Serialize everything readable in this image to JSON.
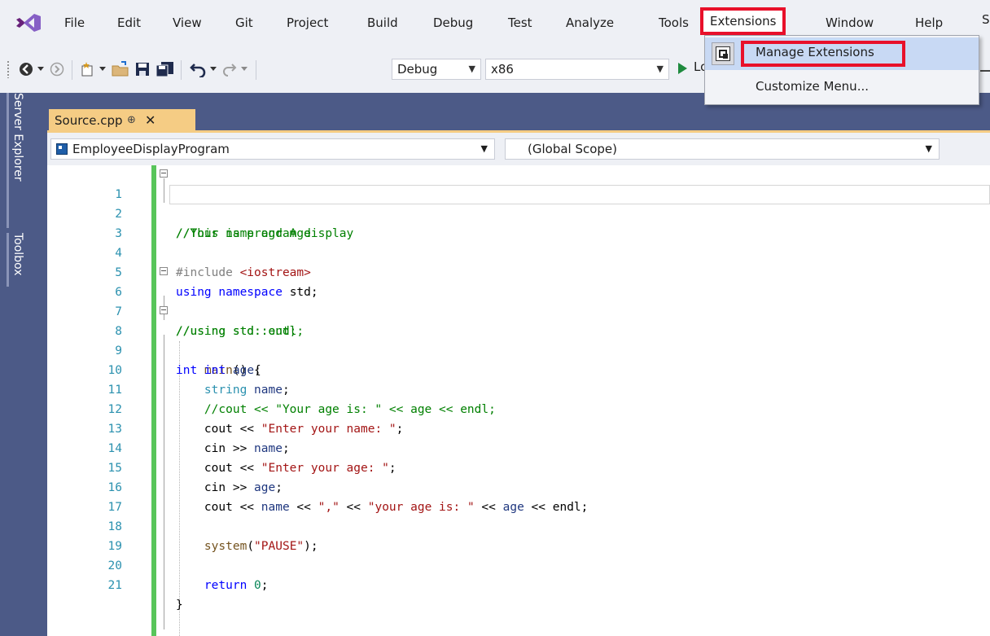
{
  "menubar": {
    "items": [
      "File",
      "Edit",
      "View",
      "Git",
      "Project",
      "Build",
      "Debug",
      "Test",
      "Analyze",
      "Tools",
      "Extensions",
      "Window",
      "Help"
    ],
    "cut_item": "S"
  },
  "toolbar": {
    "configuration": "Debug",
    "platform": "x86",
    "run_label": "Lo"
  },
  "leftstrip": {
    "server_explorer": "Server Explorer",
    "toolbox": "Toolbox"
  },
  "tab": {
    "filename": "Source.cpp",
    "pin": "⊕",
    "close": "✕"
  },
  "navbar": {
    "project": "EmployeeDisplayProgram",
    "scope": "(Global Scope)"
  },
  "dropdown": {
    "items": [
      "Manage Extensions",
      "Customize Menu..."
    ]
  },
  "code": {
    "lines": [
      "1",
      "2",
      "3",
      "4",
      "5",
      "6",
      "7",
      "8",
      "9",
      "10",
      "11",
      "12",
      "13",
      "14",
      "15",
      "16",
      "17",
      "18",
      "19",
      "20",
      "21"
    ],
    "l1": "//This is program display",
    "l2": "//Your name and Age",
    "l4_pp": "#include ",
    "l4_hdr": "<iostream>",
    "l5_kw1": "using",
    "l5_kw2": "namespace",
    "l5_rest": " std;",
    "l6": "//using std::out;",
    "l7": "//using std::endl;",
    "l8_kw": "int",
    "l8_fn": "main",
    "l8_rest": "() {",
    "l9_kw": "int",
    "l9_var": "age",
    "l10_type": "string",
    "l10_var": "name",
    "l11": "//cout << \"Your age is: \" << age << endl;",
    "l12_a": "cout << ",
    "l12_s": "\"Enter your name: \"",
    "l13_a": "cin >> ",
    "l13_v": "name",
    "l14_a": "cout << ",
    "l14_s": "\"Enter your age: \"",
    "l15_a": "cin >> ",
    "l15_v": "age",
    "l16_a": "cout << ",
    "l16_v1": "name",
    "l16_b": " << ",
    "l16_s1": "\",\"",
    "l16_c": " << ",
    "l16_s2": "\"your age is: \"",
    "l16_d": " << ",
    "l16_v2": "age",
    "l16_e": " << endl;",
    "l18_fn": "system",
    "l18_s": "\"PAUSE\"",
    "l20_kw": "return",
    "l20_num": "0",
    "l21": "}"
  }
}
